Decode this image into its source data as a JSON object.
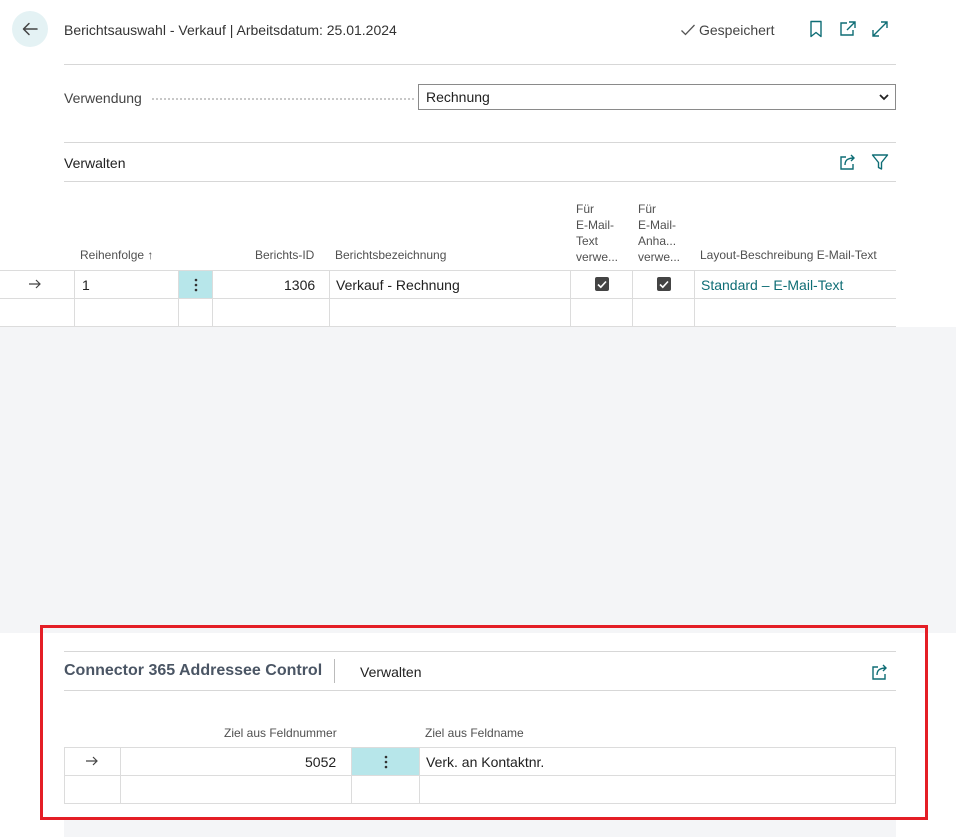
{
  "header": {
    "title": "Berichtsauswahl - Verkauf | Arbeitsdatum: 25.01.2024",
    "status": "Gespeichert"
  },
  "usage": {
    "label": "Verwendung",
    "selected": "Rechnung"
  },
  "report_list": {
    "manage_label": "Verwalten",
    "columns": {
      "sequence": "Reihenfolge",
      "sort_arrow": "↑",
      "report_id": "Berichts-ID",
      "report_name": "Berichtsbezeichnung",
      "email_text_1": "Für",
      "email_text_2": "E-Mail-",
      "email_text_3": "Text",
      "email_text_4": "verwe...",
      "email_att_1": "Für",
      "email_att_2": "E-Mail-",
      "email_att_3": "Anha...",
      "email_att_4": "verwe...",
      "layout": "Layout-Beschreibung E-Mail-Text"
    },
    "rows": [
      {
        "sequence": "1",
        "report_id": "1306",
        "report_name": "Verkauf - Rechnung",
        "email_text": true,
        "email_attachment": true,
        "layout": "Standard – E-Mail-Text"
      }
    ]
  },
  "addressee_control": {
    "title": "Connector 365 Addressee Control",
    "manage_label": "Verwalten",
    "columns": {
      "field_no": "Ziel aus Feldnummer",
      "field_name": "Ziel aus Feldname"
    },
    "rows": [
      {
        "field_no": "5052",
        "field_name": "Verk. an Kontaktnr."
      }
    ]
  },
  "colors": {
    "accent": "#0e6d75",
    "highlight_red": "#e41e26",
    "selection": "#b7e6ea"
  },
  "icons": [
    "back-arrow-icon",
    "checkmark-icon",
    "bookmark-icon",
    "open-new-window-icon",
    "expand-icon",
    "share-icon",
    "filter-icon",
    "row-arrow-icon",
    "ellipsis-icon",
    "chevron-down-icon"
  ]
}
